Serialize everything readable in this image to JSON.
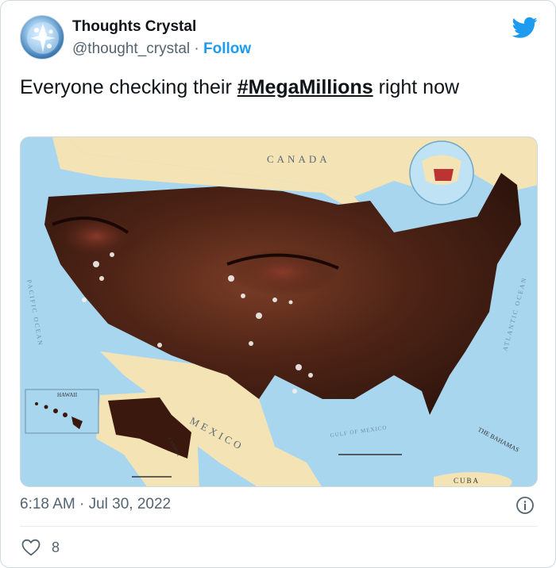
{
  "author": {
    "name": "Thoughts Crystal",
    "handle": "@thought_crystal",
    "separator": "·",
    "follow_label": "Follow"
  },
  "tweet": {
    "text_before": "Everyone checking their ",
    "hashtag": "#MegaMillions",
    "text_after": " right now"
  },
  "media": {
    "labels": {
      "canada": "CANADA",
      "mexico": "MEXICO",
      "hawaii": "HAWAII",
      "pacific": "PACIFIC OCEAN",
      "atlantic": "ATLANTIC OCEAN",
      "gulf": "GULF OF MEXICO",
      "bahamas": "THE BAHAMAS",
      "cuba": "CUBA",
      "canada_small": "CANADA"
    }
  },
  "footer": {
    "timestamp": "6:18 AM · Jul 30, 2022",
    "like_count": "8"
  },
  "icons": {
    "brand": "twitter-bird-icon",
    "info": "info-icon",
    "like": "heart-icon"
  },
  "colors": {
    "brand_blue": "#1d9bf0",
    "secondary_text": "#536471",
    "ocean": "#a9d6ef",
    "land": "#f3e3b5"
  }
}
